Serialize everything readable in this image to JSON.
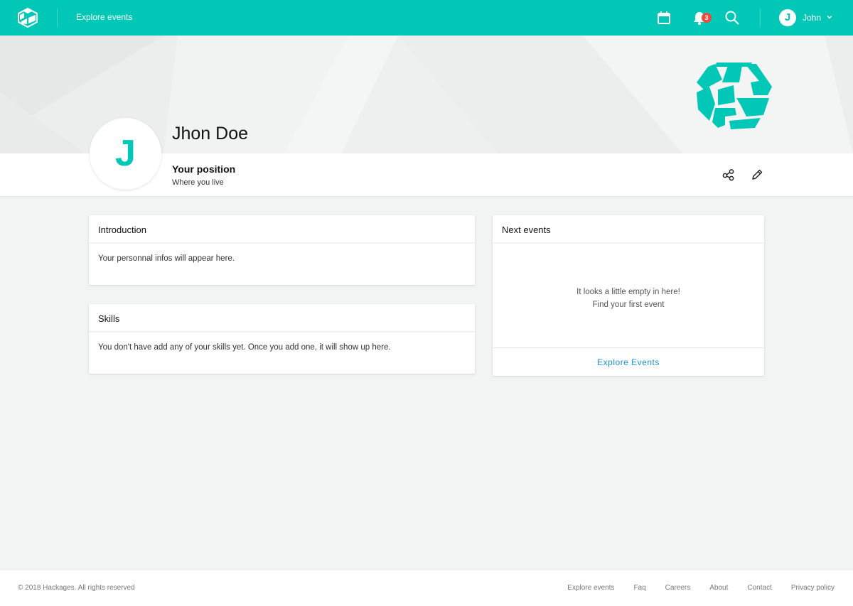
{
  "header": {
    "nav_link": "Explore events",
    "notification_count": "3",
    "user_initial": "J",
    "user_name": "John",
    "icons": [
      "hackages-logo-icon",
      "calendar-icon",
      "bell-icon",
      "search-icon",
      "chevron-down-icon"
    ]
  },
  "profile": {
    "initial": "J",
    "name": "Jhon Doe",
    "position": "Your position",
    "location": "Where you live",
    "actions": [
      "share-icon",
      "edit-icon"
    ]
  },
  "introduction": {
    "title": "Introduction",
    "text": "Your personnal infos will appear here."
  },
  "skills": {
    "title": "Skills",
    "text": "You don't have add any of your skills yet. Once you add one, it will show up here."
  },
  "next_events": {
    "title": "Next events",
    "empty_line1": "It looks a little empty in here!",
    "empty_line2": "Find your first event",
    "cta": "Explore Events"
  },
  "footer": {
    "copyright": "© 2018 Hackages. All rights reserved",
    "links": [
      "Explore events",
      "Faq",
      "Careers",
      "About",
      "Contact",
      "Privacy policy"
    ]
  },
  "colors": {
    "brand": "#01c7b7",
    "badge": "#ef4a3c",
    "link": "#1a8fd8",
    "page_bg": "#f2f3f3"
  }
}
